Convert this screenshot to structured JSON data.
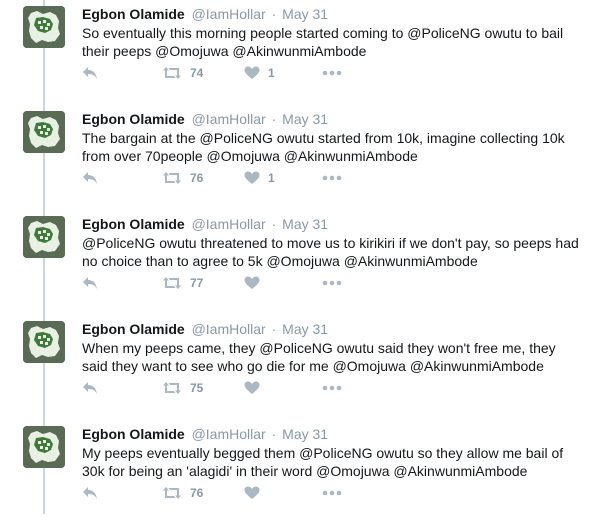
{
  "tweets": [
    {
      "name": "Egbon Olamide",
      "handle": "@IamHollar",
      "separator": "·",
      "time": "May 31",
      "text": "So eventually this morning people started coming to @PoliceNG owutu to bail\ntheir peeps @Omojuwa @AkinwunmiAmbode",
      "retweets": "74",
      "likes": "1"
    },
    {
      "name": "Egbon Olamide",
      "handle": "@IamHollar",
      "separator": "·",
      "time": "May 31",
      "text": "The bargain at the @PoliceNG owutu started from 10k, imagine collecting 10k\nfrom over 70people @Omojuwa @AkinwunmiAmbode",
      "retweets": "76",
      "likes": "1"
    },
    {
      "name": "Egbon Olamide",
      "handle": "@IamHollar",
      "separator": "·",
      "time": "May 31",
      "text": "@PoliceNG owutu threatened to move us to kirikiri if we don't pay, so peeps had\nno choice than to agree to 5k @Omojuwa @AkinwunmiAmbode",
      "retweets": "77",
      "likes": ""
    },
    {
      "name": "Egbon Olamide",
      "handle": "@IamHollar",
      "separator": "·",
      "time": "May 31",
      "text": "When my peeps came, they @PoliceNG owutu said they won't free me, they\nsaid they want to see who go die for me  @Omojuwa @AkinwunmiAmbode",
      "retweets": "75",
      "likes": ""
    },
    {
      "name": "Egbon Olamide",
      "handle": "@IamHollar",
      "separator": "·",
      "time": "May 31",
      "text": "My peeps eventually begged them @PoliceNG owutu so they allow me bail of\n30k for being an 'alagidi' in their word @Omojuwa @AkinwunmiAmbode",
      "retweets": "76",
      "likes": ""
    }
  ],
  "icons": {
    "reply": "reply-icon",
    "retweet": "retweet-icon",
    "like": "heart-icon",
    "more": "more-dots-icon"
  },
  "colors": {
    "avatar_background": "#5a6b55",
    "avatar_map": "#e8efe3",
    "action_icon": "#aab8c2",
    "thread_line": "#ccd6dd"
  }
}
